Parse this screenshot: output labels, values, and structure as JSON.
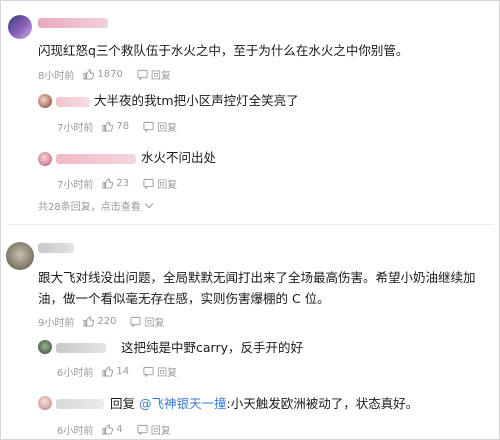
{
  "colors": {
    "text": "#1a1a1a",
    "meta": "#9a9a9a",
    "mention": "#3b7bd5",
    "divider": "#ececec"
  },
  "comments": [
    {
      "text": "闪现红怒q三个救队伍于水火之中，至于为什么在水火之中你别管。",
      "time": "8小时前",
      "likes": "1870",
      "reply_label": "回复",
      "replies": [
        {
          "text": "大半夜的我tm把小区声控灯全笑亮了",
          "time": "7小时前",
          "likes": "78",
          "reply_label": "回复"
        },
        {
          "text": "水火不问出处",
          "time": "7小时前",
          "likes": "23",
          "reply_label": "回复"
        }
      ],
      "reply_count_text": "共28条回复，点击查看"
    },
    {
      "text": "跟大飞对线没出问题，全局默默无闻打出来了全场最高伤害。希望小奶油继续加油，做一个看似毫无存在感，实则伤害爆棚的 C 位。",
      "time": "9小时前",
      "likes": "220",
      "reply_label": "回复",
      "replies": [
        {
          "text": "这把纯是中野carry，反手开的好",
          "time": "6小时前",
          "likes": "14",
          "reply_label": "回复"
        },
        {
          "prefix": "回复",
          "mention": "@飞神银天一撞",
          "text": ":小天触发欧洲被动了，状态真好。",
          "time": "6小时前",
          "likes": "4",
          "reply_label": "回复"
        }
      ]
    }
  ]
}
